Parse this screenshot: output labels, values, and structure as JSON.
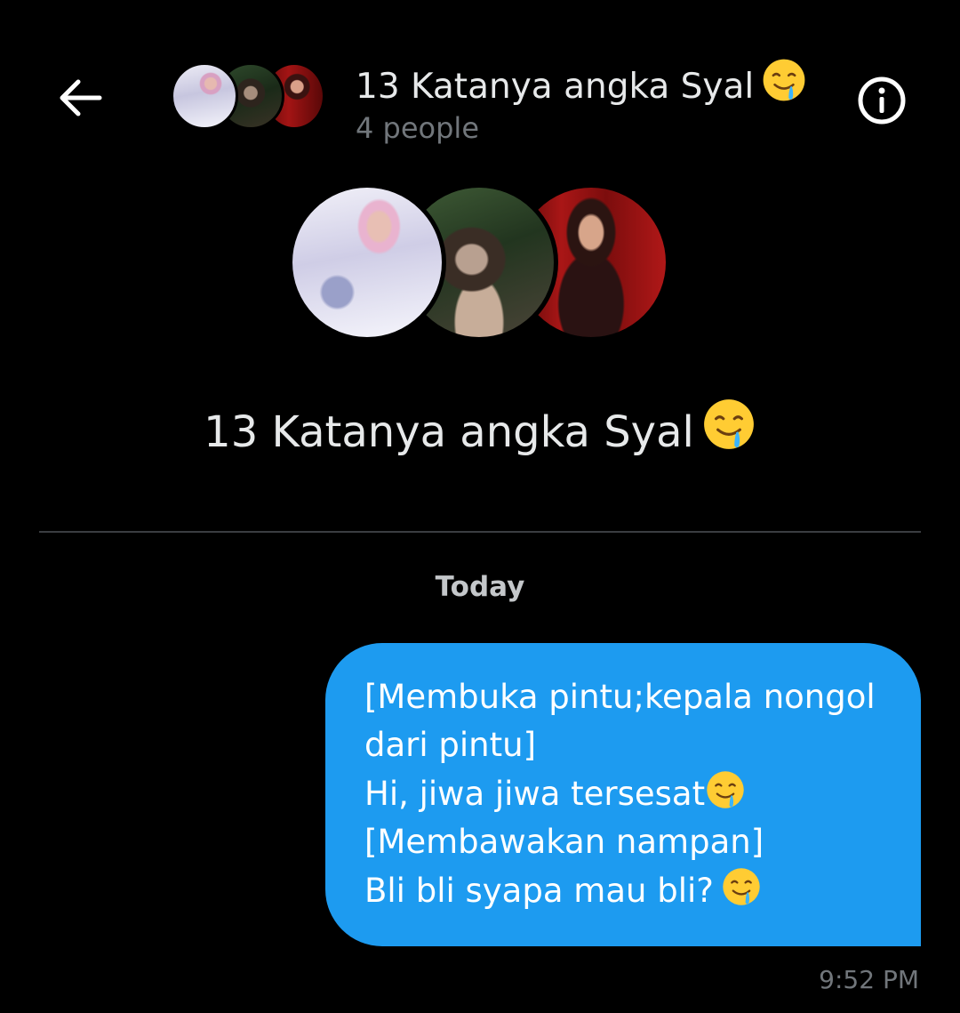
{
  "header": {
    "back_icon": "arrow-left-icon",
    "title": "13 Katanya angka Syal",
    "title_emoji": "drooling-face-emoji",
    "subtitle": "4 people",
    "info_icon": "info-circle-icon"
  },
  "group": {
    "title": "13 Katanya angka Syal",
    "title_emoji": "drooling-face-emoji",
    "avatars": [
      "member-avatar-1",
      "member-avatar-2",
      "member-avatar-3"
    ]
  },
  "conversation": {
    "date_label": "Today",
    "messages": [
      {
        "lines": [
          "[Membuka pintu;kepala nongol",
          "dari pintu]",
          "Hi, jiwa jiwa tersesat",
          "[Membawakan nampan]",
          "Bli bli syapa mau bli?"
        ],
        "time": "9:52 PM"
      }
    ]
  },
  "colors": {
    "background": "#000000",
    "bubble": "#1d9bf0",
    "text_primary": "#e7e9ea",
    "text_secondary": "#71767b",
    "divider": "#3a3d41"
  }
}
